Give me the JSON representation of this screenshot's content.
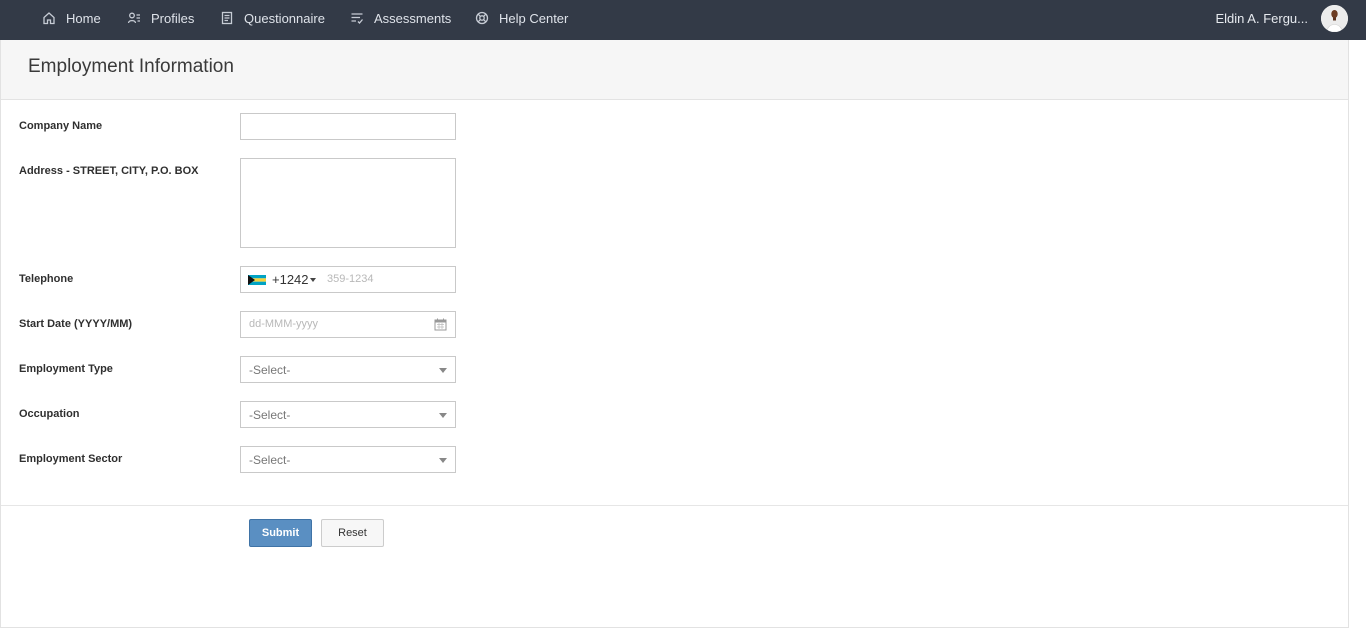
{
  "nav": {
    "items": [
      {
        "label": "Home",
        "icon": "home-icon"
      },
      {
        "label": "Profiles",
        "icon": "profiles-icon"
      },
      {
        "label": "Questionnaire",
        "icon": "questionnaire-icon"
      },
      {
        "label": "Assessments",
        "icon": "assessments-icon"
      },
      {
        "label": "Help Center",
        "icon": "help-center-icon"
      }
    ],
    "user_name": "Eldin A. Fergu..."
  },
  "page": {
    "title": "Employment Information"
  },
  "form": {
    "company_name": {
      "label": "Company Name",
      "value": ""
    },
    "address": {
      "label": "Address - STREET, CITY, P.O. BOX",
      "value": ""
    },
    "telephone": {
      "label": "Telephone",
      "dial_code": "+1242",
      "placeholder": "359-1234",
      "flag": "bahamas-flag-icon"
    },
    "start_date": {
      "label": "Start Date (YYYY/MM)",
      "placeholder": "dd-MMM-yyyy"
    },
    "employment_type": {
      "label": "Employment Type",
      "selected": "-Select-"
    },
    "occupation": {
      "label": "Occupation",
      "selected": "-Select-"
    },
    "employment_sector": {
      "label": "Employment Sector",
      "selected": "-Select-"
    }
  },
  "actions": {
    "submit_label": "Submit",
    "reset_label": "Reset"
  },
  "colors": {
    "topbar": "#333a47",
    "submit_button": "#5a8fc2",
    "header_bg": "#f6f6f6"
  }
}
